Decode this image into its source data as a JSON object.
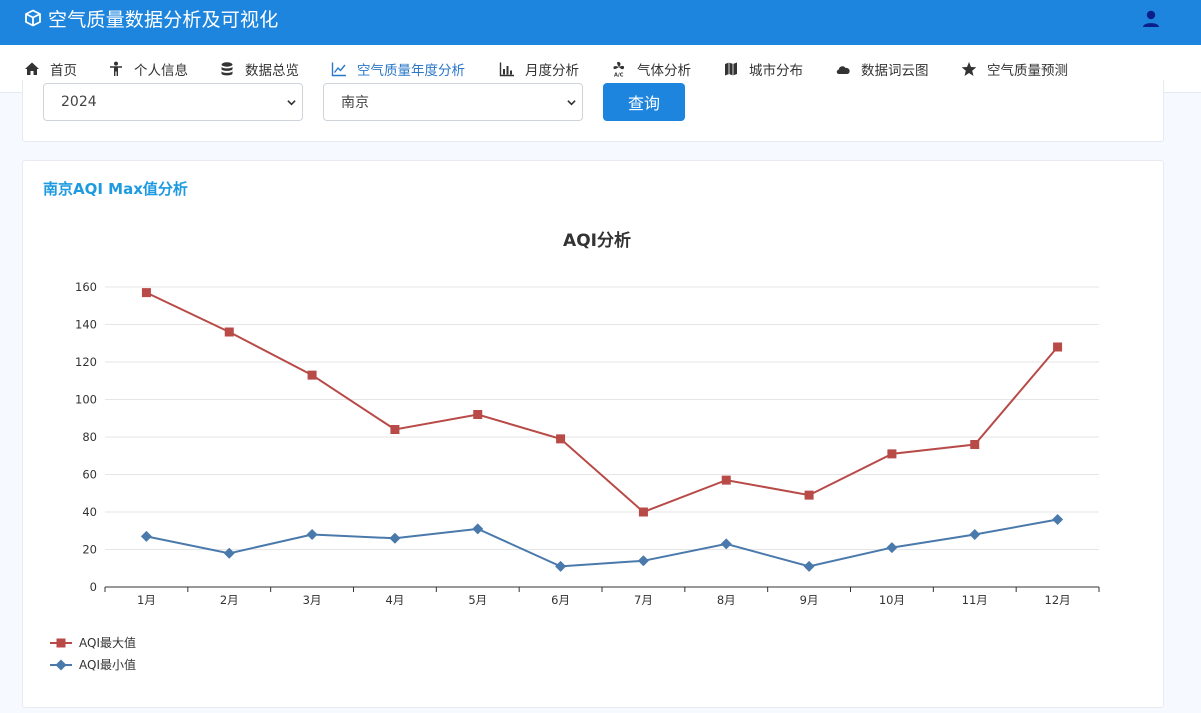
{
  "app": {
    "title": "空气质量数据分析及可视化",
    "brand_icon": "cube-icon",
    "user_icon": "user-icon",
    "accent_color": "#1e85de"
  },
  "nav": {
    "items": [
      {
        "label": "首页",
        "icon": "home-icon"
      },
      {
        "label": "个人信息",
        "icon": "person-icon"
      },
      {
        "label": "数据总览",
        "icon": "database-icon"
      },
      {
        "label": "空气质量年度分析",
        "icon": "line-chart-icon",
        "active": true
      },
      {
        "label": "月度分析",
        "icon": "bar-chart-icon"
      },
      {
        "label": "气体分析",
        "icon": "fan-icon"
      },
      {
        "label": "城市分布",
        "icon": "map-icon"
      },
      {
        "label": "数据词云图",
        "icon": "cloud-icon"
      },
      {
        "label": "空气质量预测",
        "icon": "star-icon"
      }
    ]
  },
  "filter": {
    "year_value": "2024",
    "city_value": "南京",
    "query_label": "查询"
  },
  "card": {
    "title": "南京AQI Max值分析"
  },
  "chart_data": {
    "type": "line",
    "title": "AQI分析",
    "categories": [
      "1月",
      "2月",
      "3月",
      "4月",
      "5月",
      "6月",
      "7月",
      "8月",
      "9月",
      "10月",
      "11月",
      "12月"
    ],
    "series": [
      {
        "name": "AQI最大值",
        "color": "#b84a47",
        "marker": "square",
        "values": [
          157,
          136,
          113,
          84,
          92,
          79,
          40,
          57,
          49,
          71,
          76,
          128
        ]
      },
      {
        "name": "AQI最小值",
        "color": "#4a79ab",
        "marker": "diamond",
        "values": [
          27,
          18,
          28,
          26,
          31,
          11,
          14,
          23,
          11,
          21,
          28,
          36
        ]
      }
    ],
    "yticks": [
      "0",
      "20",
      "40",
      "60",
      "80",
      "100",
      "120",
      "140",
      "160"
    ],
    "ylim": [
      0,
      160
    ],
    "grid": true,
    "legend_position": "bottom-left"
  }
}
